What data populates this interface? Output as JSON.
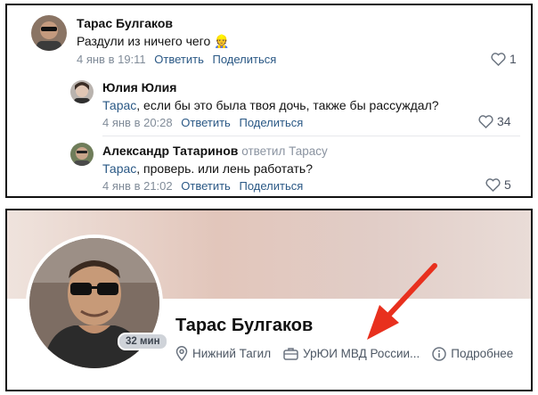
{
  "comments": [
    {
      "author": "Тарас Булгаков",
      "text": "Раздули из ничего чего",
      "emoji": "👷",
      "date": "4 янв в 19:11",
      "reply_label": "Ответить",
      "share_label": "Поделиться",
      "likes": "1"
    },
    {
      "author": "Юлия Юлия",
      "mention": "Тарас",
      "text": ", если бы это была твоя дочь, также бы рассуждал?",
      "date": "4 янв в 20:28",
      "reply_label": "Ответить",
      "share_label": "Поделиться",
      "likes": "34"
    },
    {
      "author": "Александр Татаринов",
      "replied_to": "ответил Тарасу",
      "mention": "Тарас",
      "text": ", проверь. или лень работать?",
      "date": "4 янв в 21:02",
      "reply_label": "Ответить",
      "share_label": "Поделиться",
      "likes": "5"
    }
  ],
  "profile": {
    "name": "Тарас Булгаков",
    "online_badge": "32 мин",
    "city": "Нижний Тагил",
    "work": "УрЮИ МВД России...",
    "details_label": "Подробнее"
  },
  "colors": {
    "link": "#2a5885",
    "meta": "#818c99",
    "arrow": "#e8301e"
  },
  "icons": [
    "heart-icon",
    "location-pin-icon",
    "briefcase-icon",
    "info-icon",
    "arrow-annotation"
  ]
}
